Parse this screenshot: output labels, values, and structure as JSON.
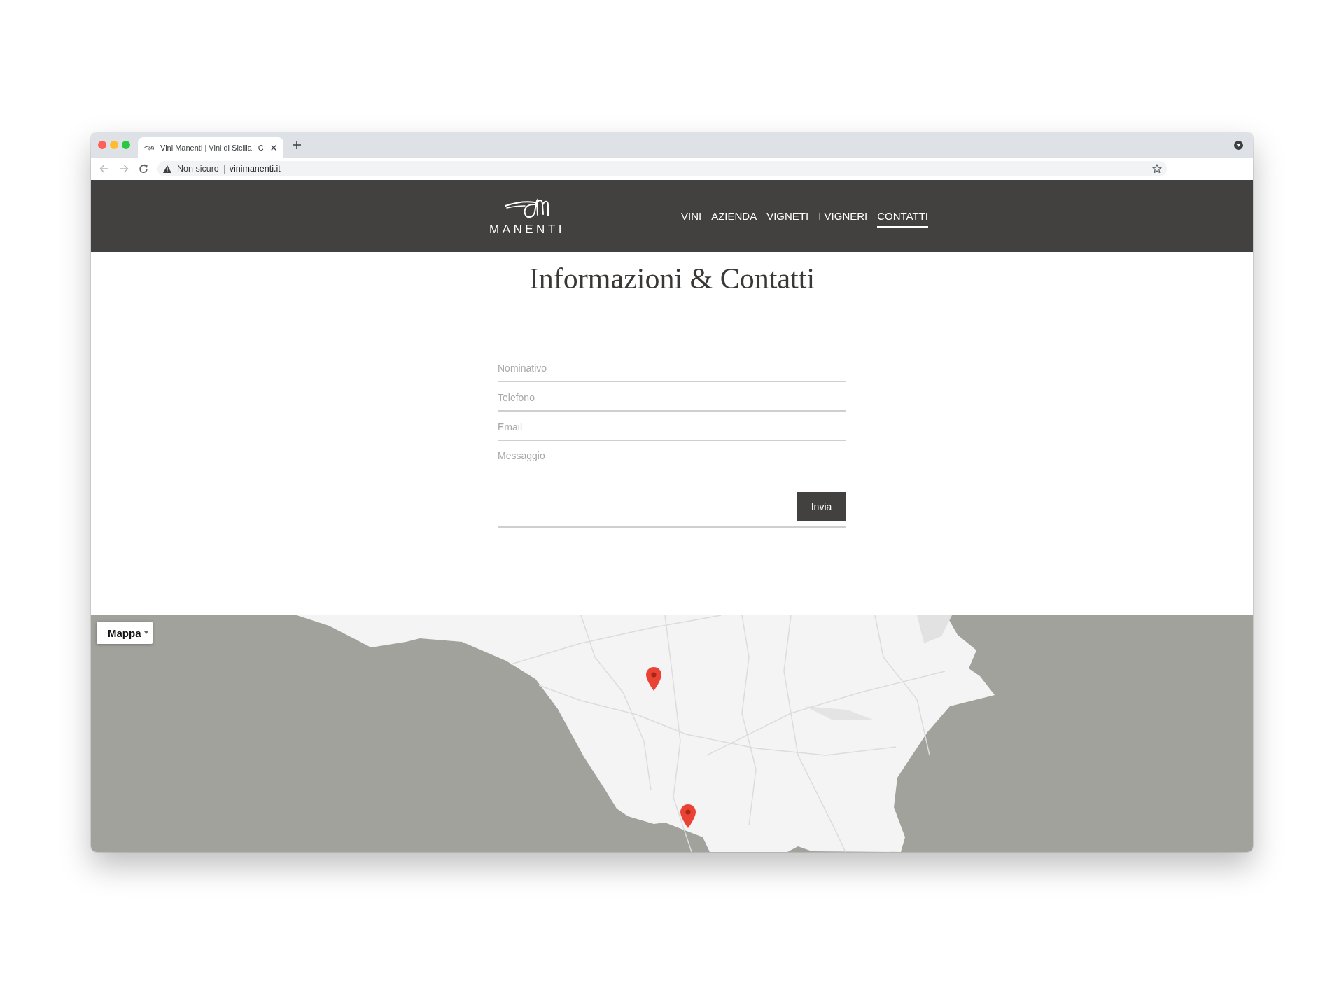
{
  "browser": {
    "tab": {
      "title": "Vini Manenti | Vini di Sicilia | C"
    },
    "address_bar": {
      "security_label": "Non sicuro",
      "url": "vinimanenti.it"
    }
  },
  "header": {
    "logo": {
      "wordmark": "MANENTI"
    },
    "nav": [
      {
        "label": "VINI",
        "selected": false
      },
      {
        "label": "AZIENDA",
        "selected": false
      },
      {
        "label": "VIGNETI",
        "selected": false
      },
      {
        "label": "I VIGNERI",
        "selected": false
      },
      {
        "label": "CONTATTI",
        "selected": true
      }
    ]
  },
  "page_title": "Informazioni & Contatti",
  "contact_form": {
    "fields": [
      {
        "kind": "input",
        "placeholder": "Nominativo"
      },
      {
        "kind": "input",
        "placeholder": "Telefono"
      },
      {
        "kind": "input",
        "placeholder": "Email"
      },
      {
        "kind": "textarea",
        "placeholder": "Messaggio"
      }
    ],
    "submit": "Invia"
  },
  "map": {
    "type_control": "Mappa"
  }
}
